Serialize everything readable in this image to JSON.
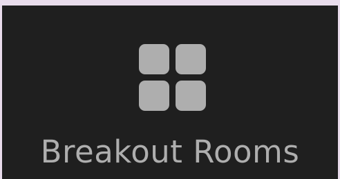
{
  "toolbar": {
    "breakout_rooms": {
      "label": "Breakout Rooms",
      "icon": "breakout-rooms-grid-icon",
      "background_color": "#1f1f1f",
      "foreground_color": "#aeaeae"
    }
  },
  "page": {
    "background_color": "#e9dcec"
  }
}
